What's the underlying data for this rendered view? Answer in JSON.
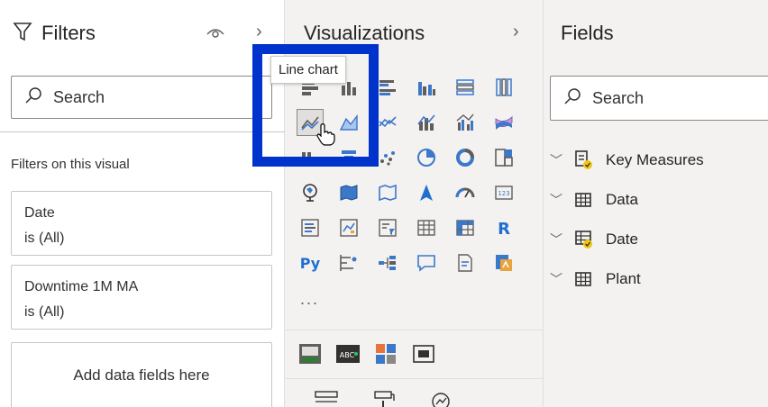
{
  "filters": {
    "title": "Filters",
    "search_placeholder": "Search",
    "section_label": "Filters on this visual",
    "cards": [
      {
        "field": "Date",
        "state": "is (All)"
      },
      {
        "field": "Downtime 1M MA",
        "state": "is (All)"
      }
    ],
    "add_fields_label": "Add data fields here"
  },
  "visualizations": {
    "title": "Visualizations",
    "tooltip": "Line chart",
    "more": "...",
    "highlight_color": "#0033cc"
  },
  "fields": {
    "title": "Fields",
    "search_placeholder": "Search",
    "tables": [
      {
        "name": "Key Measures"
      },
      {
        "name": "Data"
      },
      {
        "name": "Date"
      },
      {
        "name": "Plant"
      }
    ]
  }
}
